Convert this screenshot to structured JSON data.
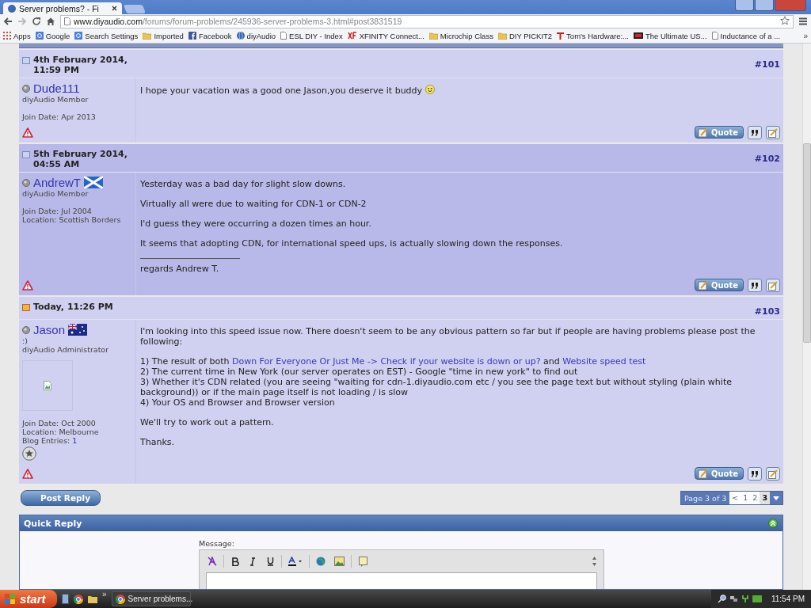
{
  "browser": {
    "tabs": [
      {
        "title": "Server problems? - Fi",
        "selected": true
      }
    ],
    "url": {
      "host": "www.diyaudio.com",
      "path": "/forums/forum-problems/245936-server-problems-3.html#post3831519"
    },
    "bookmarks": [
      {
        "kind": "apps",
        "label": "Apps"
      },
      {
        "kind": "search",
        "label": "Google"
      },
      {
        "kind": "search",
        "label": "Search Settings"
      },
      {
        "kind": "folder",
        "label": "Imported"
      },
      {
        "kind": "facebook",
        "label": "Facebook"
      },
      {
        "kind": "globe",
        "label": "diyAudio"
      },
      {
        "kind": "page",
        "label": "ESL DIY - Index"
      },
      {
        "kind": "xfinity",
        "label": "XFINITY Connect..."
      },
      {
        "kind": "folder",
        "label": "Microchip Class"
      },
      {
        "kind": "folder",
        "label": "DIY PICKIT2"
      },
      {
        "kind": "toms",
        "label": "Tom's Hardware:..."
      },
      {
        "kind": "logo",
        "label": "The Ultimate US..."
      },
      {
        "kind": "page",
        "label": "Inductance of a ..."
      }
    ],
    "more": "»"
  },
  "posts": [
    {
      "date": "4th February 2014, 11:59 PM",
      "new": false,
      "number": "#101",
      "quote_label": "Quote",
      "user": {
        "name": "Dude111",
        "title": "diyAudio Member",
        "details": [
          {
            "label": "Join Date:",
            "value": "Apr 2013",
            "link": false
          }
        ]
      },
      "body": [
        [
          [
            {
              "kind": "text",
              "text": "I hope your vacation was a good one Jason,you deserve it buddy"
            },
            {
              "kind": "smiley"
            }
          ]
        ]
      ]
    },
    {
      "date": "5th February 2014, 04:55 AM",
      "new": false,
      "number": "#102",
      "quote_label": "Quote",
      "user": {
        "name": "AndrewT",
        "flag": {
          "kind": "scotland"
        },
        "title": "diyAudio Member",
        "details": [
          {
            "label": "Join Date:",
            "value": "Jul 2004",
            "link": false
          },
          {
            "label": "Location:",
            "value": "Scottish Borders",
            "link": false
          }
        ]
      },
      "body": [
        [
          [
            {
              "kind": "text",
              "text": "Yesterday was a bad day for slight slow downs."
            }
          ]
        ],
        [
          [
            {
              "kind": "text",
              "text": "Virtually all were due to waiting for CDN-1 or CDN-2"
            }
          ]
        ],
        [
          [
            {
              "kind": "text",
              "text": "I'd guess they were occurring a dozen times an hour."
            }
          ]
        ],
        [
          [
            {
              "kind": "text",
              "text": "It seems that adopting CDN, for international speed ups, is actually slowing down the responses."
            }
          ]
        ]
      ],
      "signature": "regards Andrew T."
    },
    {
      "date": "Today, 11:26 PM",
      "new": true,
      "number": "#103",
      "quote_label": "Quote",
      "user": {
        "name": "Jason",
        "flag": {
          "kind": "australia"
        },
        "custom_title": ":)",
        "title": "diyAudio Administrator",
        "avatar": true,
        "rank_icon": true,
        "details": [
          {
            "label": "Join Date:",
            "value": "Oct 2000",
            "link": false
          },
          {
            "label": "Location:",
            "value": "Melbourne",
            "link": false
          },
          {
            "label": "Blog Entries:",
            "value": "1",
            "link": true
          }
        ]
      },
      "body": [
        [
          [
            {
              "kind": "text",
              "text": "I'm looking into this speed issue now. There doesn't seem to be any obvious pattern so far but if people are having problems please post the following:"
            }
          ]
        ],
        [
          [
            {
              "kind": "text",
              "text": "1) The result of both "
            },
            {
              "kind": "link",
              "text": "Down For Everyone Or Just Me -> Check if your website is down or up?"
            },
            {
              "kind": "text",
              "text": " and "
            },
            {
              "kind": "link",
              "text": "Website speed test"
            }
          ],
          [
            {
              "kind": "text",
              "text": "2) The current time in New York (our server operates on EST) - Google \"time in new york\" to find out"
            }
          ],
          [
            {
              "kind": "text",
              "text": "3) Whether it's CDN related (you are seeing \"waiting for cdn-1.diyaudio.com etc / you see the page text but without styling (plain white background)) or if the main page itself is not loading / is slow"
            }
          ],
          [
            {
              "kind": "text",
              "text": "4) Your OS and Browser and Browser version"
            }
          ]
        ],
        [
          [
            {
              "kind": "text",
              "text": "We'll try to work out a pattern."
            }
          ]
        ],
        [
          [
            {
              "kind": "text",
              "text": "Thanks."
            }
          ]
        ]
      ]
    }
  ],
  "post_reply": "Post Reply",
  "pagination": {
    "summary": "Page 3 of 3",
    "prev": "<",
    "pages": [
      {
        "label": "1",
        "selected": false
      },
      {
        "label": "2",
        "selected": false
      },
      {
        "label": "3",
        "selected": true
      }
    ]
  },
  "quick_reply": {
    "title": "Quick Reply",
    "message_label": "Message:"
  },
  "taskbar": {
    "start": "start",
    "more": "»",
    "tasks": [
      {
        "label": "Server problems...",
        "selected": true
      }
    ],
    "clock": "11:54 PM"
  }
}
